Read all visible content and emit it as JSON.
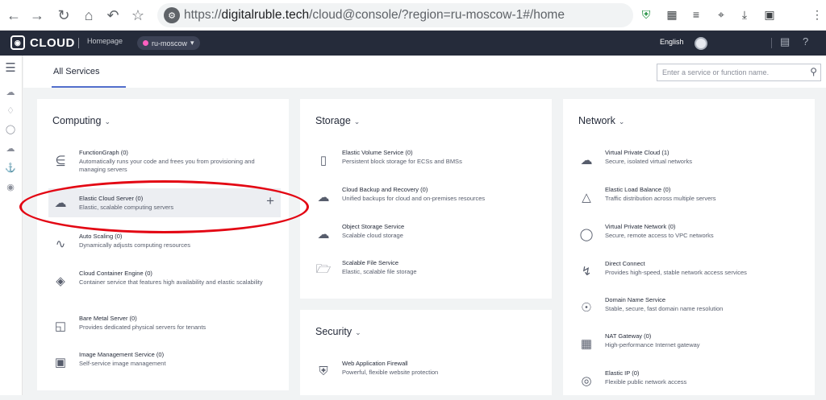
{
  "browser": {
    "url_prefix": "https://",
    "url_domain": "digitalruble.tech",
    "url_path": "/cloud@console/?region=ru-moscow-1#/home"
  },
  "topbar": {
    "logo": "CLOUD",
    "homepage": "Homepage",
    "region": "ru-moscow",
    "language": "English",
    "help": "?"
  },
  "subheader": {
    "tab": "All Services",
    "search_placeholder": "Enter a service or function name."
  },
  "computing": {
    "title": "Computing",
    "items": [
      {
        "name": "FunctionGraph",
        "count": "0",
        "desc": "Automatically runs your code and frees you from provisioning and managing servers"
      },
      {
        "name": "Elastic Cloud Server",
        "count": "0",
        "desc": "Elastic, scalable computing servers",
        "highlighted": true
      },
      {
        "name": "Auto Scaling",
        "count": "0",
        "desc": "Dynamically adjusts computing resources"
      },
      {
        "name": "Cloud Container Engine",
        "count": "0",
        "desc": "Container service that features high availability and elastic scalability"
      },
      {
        "name": "Bare Metal Server",
        "count": "0",
        "desc": "Provides dedicated physical servers for tenants"
      },
      {
        "name": "Image Management Service",
        "count": "0",
        "desc": "Self-service image management"
      }
    ]
  },
  "storage": {
    "title": "Storage",
    "items": [
      {
        "name": "Elastic Volume Service",
        "count": "0",
        "desc": "Persistent block storage for ECSs and BMSs"
      },
      {
        "name": "Cloud Backup and Recovery",
        "count": "0",
        "desc": "Unified backups for cloud and on-premises resources"
      },
      {
        "name": "Object Storage Service",
        "count": "",
        "desc": "Scalable cloud storage"
      },
      {
        "name": "Scalable File Service",
        "count": "",
        "desc": "Elastic, scalable file storage"
      }
    ]
  },
  "security": {
    "title": "Security",
    "items": [
      {
        "name": "Web Application Firewall",
        "count": "",
        "desc": "Powerful, flexible website protection"
      }
    ]
  },
  "network": {
    "title": "Network",
    "items": [
      {
        "name": "Virtual Private Cloud",
        "count": "1",
        "desc": "Secure, isolated virtual networks"
      },
      {
        "name": "Elastic Load Balance",
        "count": "0",
        "desc": "Traffic distribution across multiple servers"
      },
      {
        "name": "Virtual Private Network",
        "count": "0",
        "desc": "Secure, remote access to VPC networks"
      },
      {
        "name": "Direct Connect",
        "count": "",
        "desc": "Provides high-speed, stable network access services"
      },
      {
        "name": "Domain Name Service",
        "count": "",
        "desc": "Stable, secure, fast domain name resolution"
      },
      {
        "name": "NAT Gateway",
        "count": "0",
        "desc": "High-performance Internet gateway"
      },
      {
        "name": "Elastic IP",
        "count": "0",
        "desc": "Flexible public network access"
      }
    ]
  },
  "colors": {
    "topbar": "#252b3a",
    "accent": "#526ecc",
    "annotation": "#e30613"
  }
}
